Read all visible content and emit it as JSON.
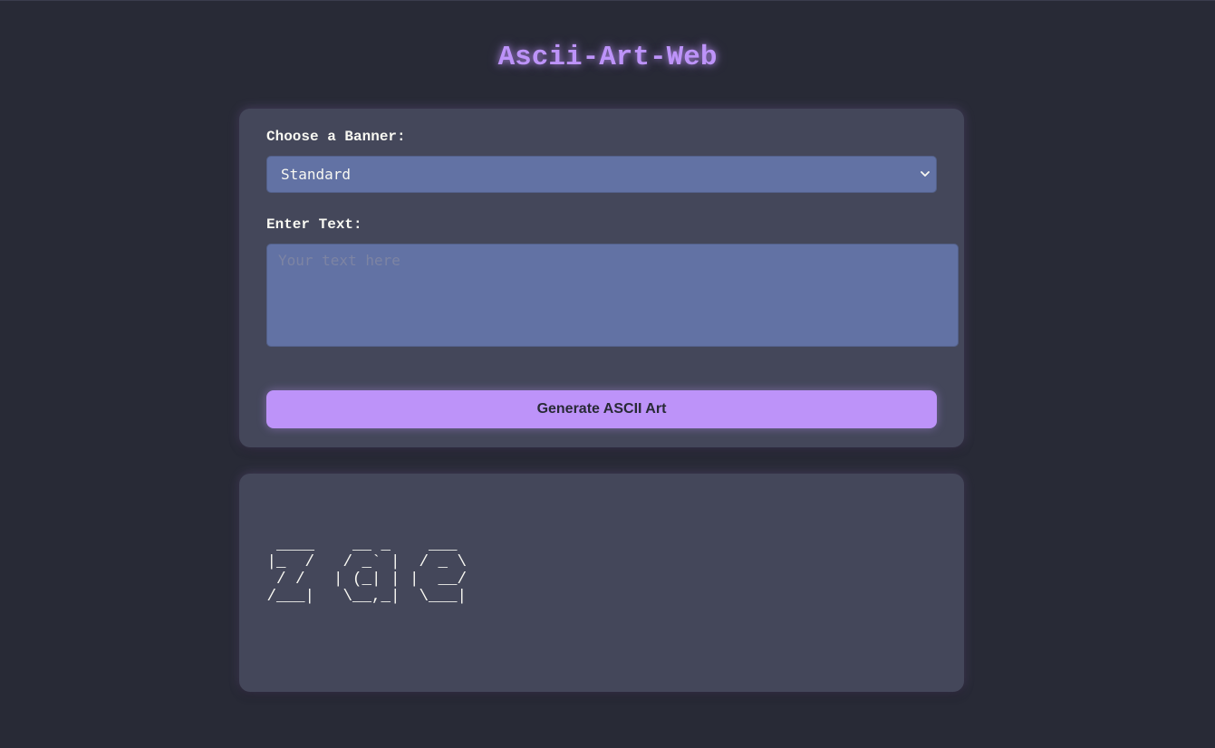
{
  "page": {
    "title": "Ascii-Art-Web"
  },
  "form": {
    "banner_label": "Choose a Banner:",
    "banner_selected": "Standard",
    "text_label": "Enter Text:",
    "text_placeholder": "Your text here",
    "text_value": "",
    "generate_label": "Generate ASCII Art"
  },
  "output": {
    "ascii_art": "  ____    __ _    ___ \n |_  /   / _` |  / _ \\\n  / /   | (_| | |  __/\n /___|   \\__,_|  \\___|"
  },
  "colors": {
    "background": "#282a36",
    "card": "#44475a",
    "input": "#6272a4",
    "accent": "#bd93f9",
    "text": "#f8f8f2"
  },
  "icons": {
    "select_arrow": "chevron-down-icon"
  }
}
